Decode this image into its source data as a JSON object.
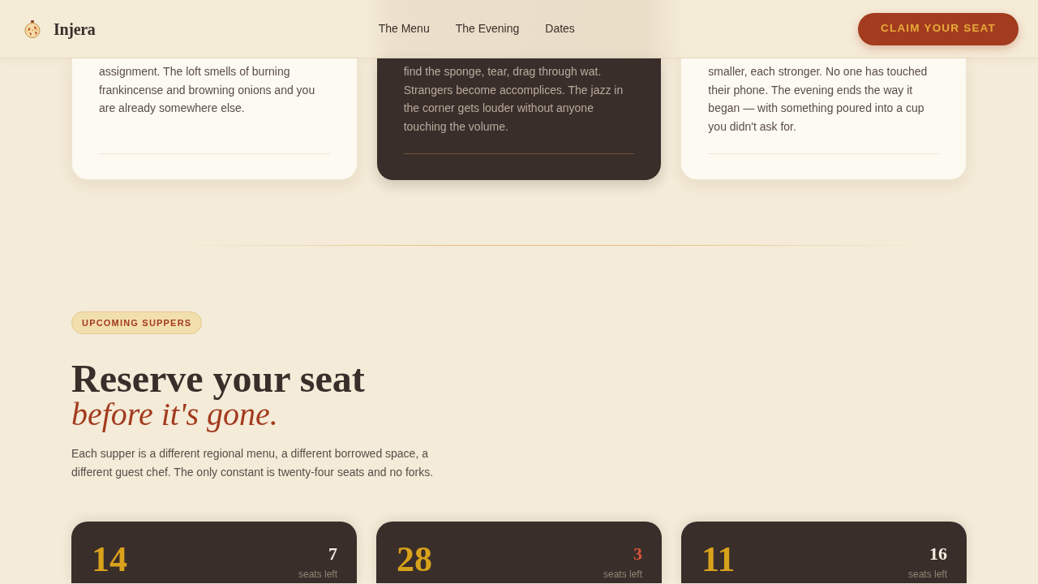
{
  "nav": {
    "brand": "Injera",
    "links": [
      "The Menu",
      "The Evening",
      "Dates"
    ],
    "cta": "CLAIM YOUR SEAT"
  },
  "story_cards": [
    {
      "kind": "light",
      "text": "assignment. The loft smells of burning frankincense and browning onions and you are already somewhere else."
    },
    {
      "kind": "dark",
      "text": "find the sponge, tear, drag through wat. Strangers become accomplices. The jazz in the corner gets louder without anyone touching the volume."
    },
    {
      "kind": "light",
      "text": "smaller, each stronger. No one has touched their phone. The evening ends the way it began — with something poured into a cup you didn't ask for."
    }
  ],
  "reserve": {
    "badge": "UPCOMING SUPPERS",
    "title": "Reserve your seat",
    "subtitle": "before it's gone.",
    "description": "Each supper is a different regional menu, a different borrowed space, a different guest chef. The only constant is twenty-four seats and no forks."
  },
  "suppers": [
    {
      "day": "14",
      "seats": "7",
      "seats_label": "seats left",
      "almost_full": false
    },
    {
      "day": "28",
      "seats": "3",
      "seats_label": "seats left",
      "almost_full": true
    },
    {
      "day": "11",
      "seats": "16",
      "seats_label": "seats left",
      "almost_full": false
    }
  ]
}
